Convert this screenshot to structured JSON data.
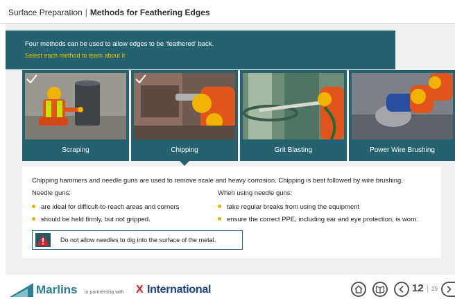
{
  "header": {
    "section": "Surface Preparation",
    "separator": "|",
    "topic": "Methods for Feathering Edges"
  },
  "intro": {
    "text": "Four methods can be used to allow edges to be ‘feathered’ back.",
    "prompt": "Select each method to learn about it"
  },
  "methods": [
    {
      "label": "Scraping",
      "visited": true,
      "active": false
    },
    {
      "label": "Chipping",
      "visited": true,
      "active": true
    },
    {
      "label": "Grit Blasting",
      "visited": false,
      "active": false
    },
    {
      "label": "Power Wire Brushing",
      "visited": false,
      "active": false
    }
  ],
  "info": {
    "lead": "Chipping hammers and needle guns are used to remove scale and heavy corrosion. Chipping is best followed by wire brushing.",
    "left_heading": "Needle guns:",
    "left_bullets": [
      "are ideal for difficult-to-reach areas and corners",
      "should be held firmly, but not gripped."
    ],
    "right_heading": "When using needle guns:",
    "right_bullets": [
      "take regular breaks from using the equipment",
      "ensure the correct PPE, including ear and eye protection, is worn."
    ],
    "warning": "Do not allow needles to dig into the surface of the metal."
  },
  "footer": {
    "brand": "Marlins",
    "partner_text": "in partnership with",
    "partner_mark": "X",
    "partner_name": "International",
    "page_current": "12",
    "page_separator": "|",
    "page_total": "29"
  },
  "icons": {
    "home": "home-icon",
    "glossary": "book-icon",
    "back": "chevron-left-icon",
    "next": "chevron-right-icon",
    "warning": "warning-triangle-icon",
    "visited": "checkmark-icon"
  },
  "colors": {
    "teal": "#24636e",
    "prompt": "#e9c400",
    "bullet": "#e6b000",
    "warning_red": "#d8222a"
  }
}
